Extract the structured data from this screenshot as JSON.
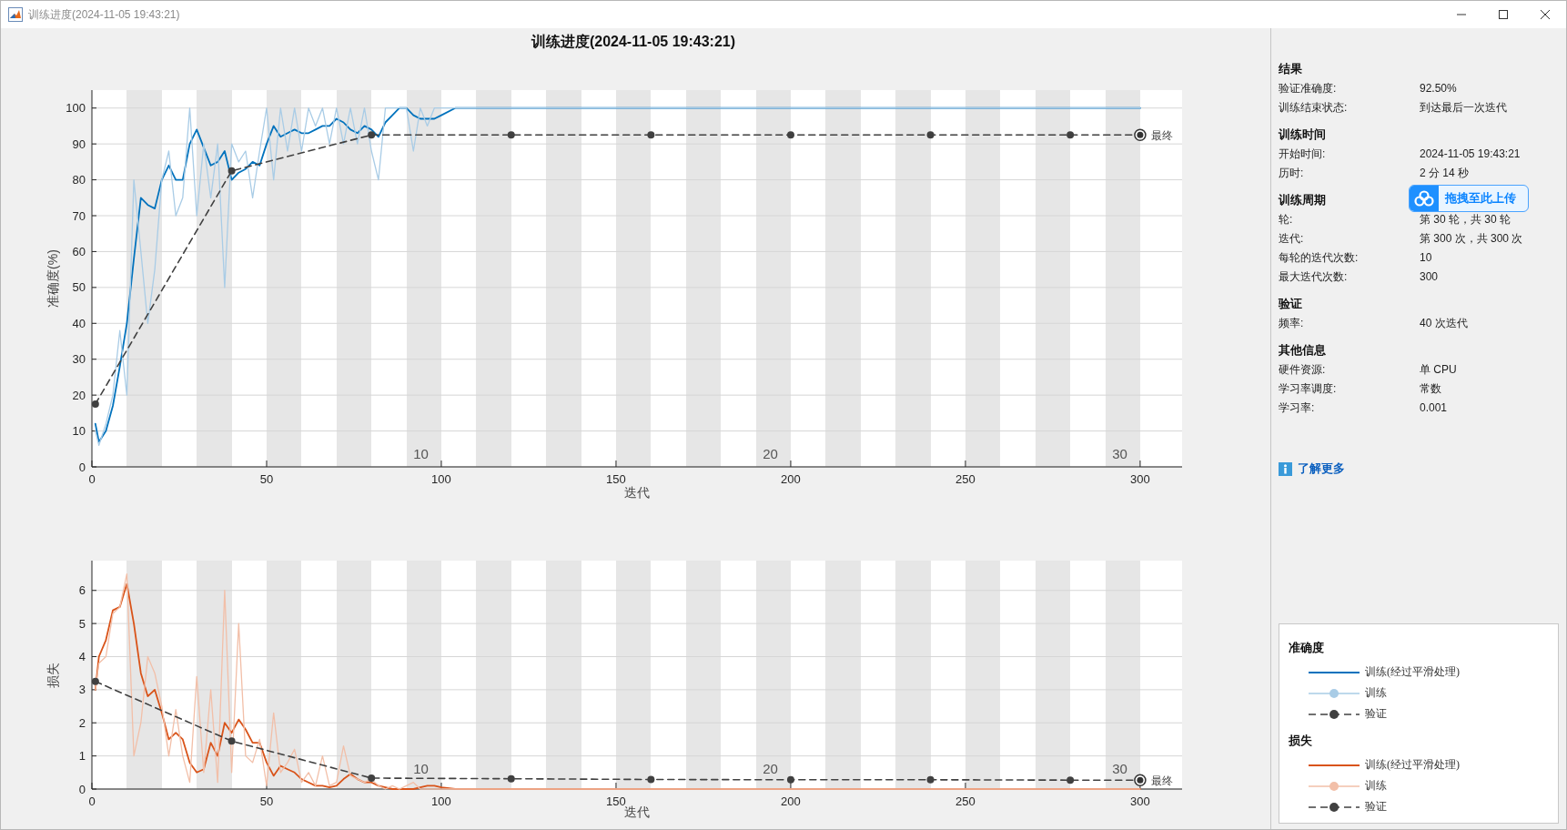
{
  "window": {
    "title": "训练进度(2024-11-05 19:43:21)"
  },
  "figure": {
    "title": "训练进度(2024-11-05 19:43:21)",
    "charts": [
      {
        "chart_data": {
          "type": "line",
          "xlabel": "迭代",
          "ylabel": "准确度(%)",
          "x": [
            1,
            2,
            4,
            6,
            8,
            10,
            12,
            14,
            16,
            18,
            20,
            22,
            24,
            26,
            28,
            30,
            32,
            34,
            36,
            38,
            40,
            42,
            44,
            46,
            48,
            50,
            52,
            54,
            56,
            58,
            60,
            62,
            64,
            66,
            68,
            70,
            72,
            74,
            76,
            78,
            80,
            82,
            84,
            86,
            88,
            90,
            92,
            94,
            96,
            98,
            100,
            104,
            120,
            160,
            200,
            240,
            280,
            300
          ],
          "series": [
            {
              "color": "#0072bd",
              "line_style": "solid",
              "values": [
                12,
                7,
                10,
                17,
                28,
                40,
                58,
                75,
                73,
                72,
                80,
                84,
                80,
                80,
                90,
                94,
                89,
                84,
                85,
                88,
                80,
                82,
                83,
                85,
                84,
                90,
                95,
                92,
                93,
                94,
                93,
                93,
                94,
                95,
                95,
                97,
                96,
                94,
                93,
                95,
                94,
                92,
                96,
                98,
                100,
                100,
                98,
                97,
                97,
                97,
                98,
                100,
                100,
                100,
                100,
                100,
                100,
                100
              ]
            },
            {
              "color": "#a9cce6",
              "line_style": "solid",
              "values": [
                10,
                6,
                12,
                20,
                38,
                20,
                80,
                60,
                40,
                55,
                80,
                88,
                70,
                75,
                100,
                70,
                90,
                75,
                90,
                50,
                90,
                85,
                88,
                75,
                88,
                100,
                80,
                100,
                88,
                100,
                88,
                100,
                95,
                100,
                90,
                100,
                90,
                100,
                90,
                100,
                88,
                80,
                100,
                100,
                100,
                100,
                88,
                100,
                95,
                100,
                100,
                100,
                100,
                100,
                100,
                100,
                100,
                100
              ]
            },
            {
              "color": "#404040",
              "line_style": "dashed",
              "marker": "o",
              "values": [
                17.5,
                null,
                null,
                null,
                null,
                null,
                null,
                null,
                null,
                null,
                null,
                null,
                null,
                null,
                null,
                null,
                null,
                null,
                null,
                null,
                82.5,
                null,
                null,
                null,
                null,
                null,
                null,
                null,
                null,
                null,
                null,
                null,
                null,
                null,
                null,
                null,
                null,
                null,
                null,
                null,
                92.5,
                null,
                null,
                null,
                null,
                null,
                null,
                null,
                null,
                null,
                null,
                null,
                92.5,
                92.5,
                92.5,
                92.5,
                92.5,
                92.5
              ]
            }
          ],
          "xlim": [
            0,
            312
          ],
          "ylim": [
            0,
            105
          ],
          "xticks": [
            0,
            50,
            100,
            150,
            200,
            250,
            300
          ],
          "yticks": [
            0,
            10,
            20,
            30,
            40,
            50,
            60,
            70,
            80,
            90,
            100
          ],
          "grid": true,
          "annotations": [
            "10",
            "20",
            "30",
            {
              "x": 300,
              "y": 92.5,
              "text": "最终"
            }
          ]
        }
      },
      {
        "chart_data": {
          "type": "line",
          "xlabel": "迭代",
          "ylabel": "损失",
          "x": [
            1,
            2,
            4,
            6,
            8,
            10,
            12,
            14,
            16,
            18,
            20,
            22,
            24,
            26,
            28,
            30,
            32,
            34,
            36,
            38,
            40,
            42,
            44,
            46,
            48,
            50,
            52,
            54,
            56,
            58,
            60,
            62,
            64,
            66,
            68,
            70,
            72,
            74,
            76,
            78,
            80,
            82,
            84,
            86,
            88,
            90,
            92,
            94,
            96,
            98,
            100,
            104,
            120,
            160,
            200,
            240,
            280,
            300
          ],
          "series": [
            {
              "color": "#d95319",
              "line_style": "solid",
              "values": [
                3,
                4,
                4.5,
                5.4,
                5.5,
                6.2,
                5,
                3.5,
                2.8,
                3,
                2.3,
                1.5,
                1.7,
                1.5,
                0.8,
                0.5,
                0.6,
                1.4,
                1,
                2,
                1.7,
                2.1,
                1.8,
                1.4,
                1.4,
                0.8,
                0.4,
                0.7,
                0.6,
                0.5,
                0.3,
                0.2,
                0.1,
                0.1,
                0.05,
                0.1,
                0.3,
                0.45,
                0.3,
                0.2,
                0.2,
                0.1,
                0.05,
                0,
                0,
                0,
                0,
                0.05,
                0.1,
                0.1,
                0.05,
                0,
                0,
                0,
                0,
                0,
                0,
                0
              ]
            },
            {
              "color": "#f2bfa8",
              "line_style": "solid",
              "values": [
                3,
                3.8,
                4,
                5.3,
                5.5,
                6.5,
                1,
                2,
                4,
                3.5,
                2.5,
                1,
                2.4,
                1,
                0.2,
                3.4,
                0.5,
                3,
                0.2,
                6,
                0.5,
                5,
                1,
                0.8,
                1.5,
                0.1,
                2.3,
                0.5,
                0.8,
                1.2,
                0.2,
                0.5,
                0.1,
                1,
                0.1,
                0.2,
                1.3,
                0.4,
                0.3,
                0.2,
                0.3,
                0.1,
                0,
                0.1,
                0,
                0.1,
                0.2,
                0,
                0,
                0,
                0,
                0,
                0,
                0,
                0,
                0,
                0,
                0
              ]
            },
            {
              "color": "#404040",
              "line_style": "dashed",
              "marker": "o",
              "values": [
                3.25,
                null,
                null,
                null,
                null,
                null,
                null,
                null,
                null,
                null,
                null,
                null,
                null,
                null,
                null,
                null,
                null,
                null,
                null,
                null,
                1.45,
                null,
                null,
                null,
                null,
                null,
                null,
                null,
                null,
                null,
                null,
                null,
                null,
                null,
                null,
                null,
                null,
                null,
                null,
                null,
                0.33,
                null,
                null,
                null,
                null,
                null,
                null,
                null,
                null,
                null,
                null,
                null,
                0.31,
                0.29,
                0.28,
                0.28,
                0.27,
                0.27
              ]
            }
          ],
          "xlim": [
            0,
            312
          ],
          "ylim": [
            0,
            6.9
          ],
          "xticks": [
            0,
            50,
            100,
            150,
            200,
            250,
            300
          ],
          "yticks": [
            0,
            1,
            2,
            3,
            4,
            5,
            6
          ],
          "grid": true,
          "annotations": [
            "10",
            "20",
            "30",
            {
              "x": 300,
              "y": 0.27,
              "text": "最终"
            }
          ]
        }
      }
    ]
  },
  "info_panel": {
    "sections": [
      {
        "title": "结果",
        "rows": [
          {
            "label": "验证准确度:",
            "value": "92.50%"
          },
          {
            "label": "训练结束状态:",
            "value": "到达最后一次迭代"
          }
        ]
      },
      {
        "title": "训练时间",
        "rows": [
          {
            "label": "开始时间:",
            "value": "2024-11-05 19:43:21"
          },
          {
            "label": "历时:",
            "value": "2 分 14 秒"
          }
        ]
      },
      {
        "title": "训练周期",
        "rows": [
          {
            "label": "轮:",
            "value": "第 30 轮，共 30 轮"
          },
          {
            "label": "迭代:",
            "value": "第 300 次，共 300 次"
          },
          {
            "label": "每轮的迭代次数:",
            "value": "10"
          },
          {
            "label": "最大迭代次数:",
            "value": "300"
          }
        ]
      },
      {
        "title": "验证",
        "rows": [
          {
            "label": "频率:",
            "value": "40 次迭代"
          }
        ]
      },
      {
        "title": "其他信息",
        "rows": [
          {
            "label": "硬件资源:",
            "value": "单 CPU"
          },
          {
            "label": "学习率调度:",
            "value": "常数"
          },
          {
            "label": "学习率:",
            "value": "0.001"
          }
        ]
      }
    ],
    "link": "了解更多"
  },
  "upload_widget": {
    "label": "拖拽至此上传"
  },
  "legend": {
    "sections": [
      {
        "title": "准确度",
        "items": [
          {
            "label": "训练(经过平滑处理)"
          },
          {
            "label": "训练"
          },
          {
            "label": "验证"
          }
        ]
      },
      {
        "title": "损失",
        "items": [
          {
            "label": "训练(经过平滑处理)"
          },
          {
            "label": "训练"
          },
          {
            "label": "验证"
          }
        ]
      }
    ]
  }
}
